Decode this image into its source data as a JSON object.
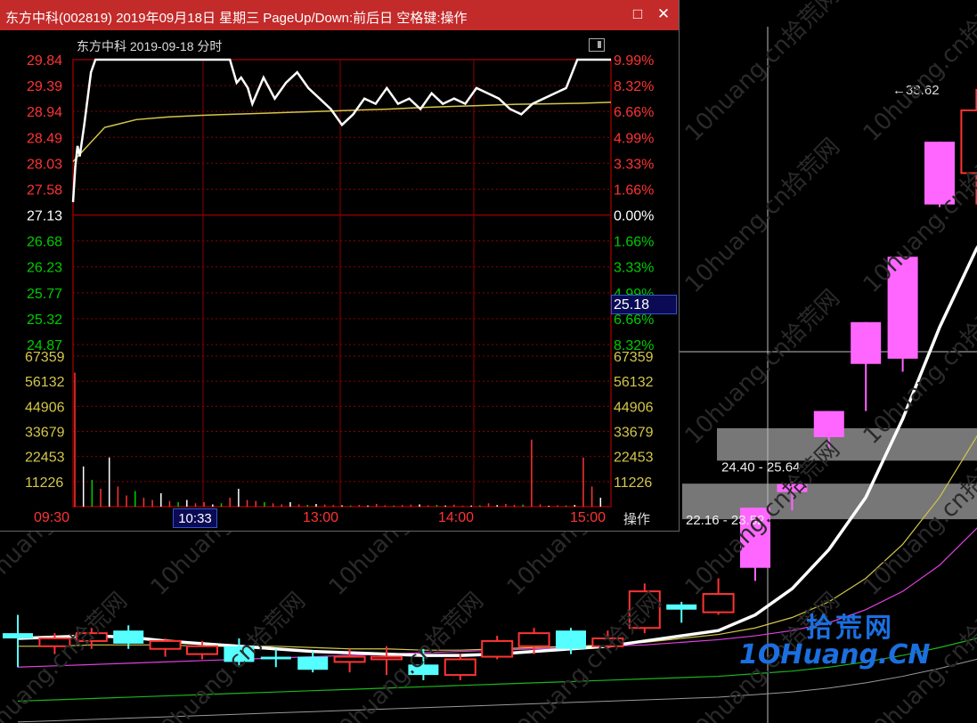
{
  "window": {
    "title": "东方中科(002819) 2019年09月18日 星期三 PageUp/Down:前后日 空格键:操作",
    "subhead": "东方中科  2019-09-18 分时",
    "restore_icon": "□",
    "close_icon": "✕",
    "operate_label": "操作",
    "current_price_box": "25.18",
    "cursor_time_box": "10:33"
  },
  "colors": {
    "up": "#ff3333",
    "down": "#00cc00",
    "neutral": "#ffffff",
    "volume_axis": "#d4c64a",
    "grid": "#8b0000",
    "title_bar": "#c32a2a",
    "magenta": "#ff66ff",
    "cyan": "#55ffff",
    "zone_gray": "#8c8c8c",
    "logo_blue": "#1b6fe0"
  },
  "chart_data": [
    {
      "type": "line",
      "name_shown": "东方中科 2019-09-18 分时",
      "price_ticks_left": [
        "29.84",
        "29.39",
        "28.94",
        "28.49",
        "28.03",
        "27.58",
        "27.13",
        "26.68",
        "26.23",
        "25.77",
        "25.32",
        "24.87"
      ],
      "pct_ticks_right": [
        "9.99%",
        "8.32%",
        "6.66%",
        "4.99%",
        "3.33%",
        "1.66%",
        "0.00%",
        "1.66%",
        "3.33%",
        "4.99%",
        "6.66%",
        "8.32%"
      ],
      "volume_ticks": [
        "67359",
        "56132",
        "44906",
        "33679",
        "22453",
        "11226"
      ],
      "time_ticks": [
        "09:30",
        "10:33",
        "13:00",
        "14:00",
        "15:00"
      ],
      "ylim": [
        24.42,
        29.84
      ],
      "prev_close": 27.13,
      "minutes": [
        0,
        1,
        2,
        3,
        5,
        8,
        10,
        12,
        15,
        20,
        25,
        30,
        40,
        50,
        60,
        70,
        73,
        75,
        78,
        80,
        85,
        90,
        95,
        100,
        105,
        110,
        115,
        120,
        125,
        130,
        135,
        140,
        145,
        150,
        155,
        160,
        165,
        170,
        175,
        180,
        185,
        190,
        195,
        200,
        205,
        210,
        215,
        220,
        225,
        230,
        231,
        232,
        235,
        240
      ],
      "price": [
        27.13,
        27.8,
        28.2,
        28.0,
        28.6,
        29.6,
        29.84,
        29.84,
        29.84,
        29.84,
        29.84,
        29.84,
        29.84,
        29.84,
        29.84,
        29.84,
        29.4,
        29.5,
        29.3,
        29.0,
        29.5,
        29.1,
        29.4,
        29.6,
        29.3,
        29.1,
        28.9,
        28.6,
        28.8,
        29.1,
        29.0,
        29.3,
        29.0,
        29.1,
        28.9,
        29.2,
        29.0,
        29.1,
        29.0,
        29.3,
        29.2,
        29.1,
        28.9,
        28.8,
        29.0,
        29.1,
        29.2,
        29.3,
        29.84,
        29.84,
        29.84,
        29.84,
        29.84,
        29.84
      ],
      "avg_line": [
        27.9,
        28.55,
        28.7,
        28.75,
        28.78,
        28.8,
        28.82,
        28.84,
        28.86,
        28.88,
        28.9,
        28.93,
        28.95,
        28.97,
        28.99,
        29.0,
        29.01,
        29.03
      ],
      "volume_bar_values": [
        60000,
        18000,
        12000,
        8000,
        22000,
        9000,
        5000,
        7000,
        4000,
        3000,
        6000,
        2500,
        2000,
        3000,
        1500,
        2000,
        1000,
        1500,
        4000,
        8000,
        3000,
        2500,
        2000,
        1500,
        1000,
        2000,
        1000,
        800,
        1200,
        900,
        700,
        600,
        500,
        800,
        500,
        1200,
        600,
        500,
        700,
        900,
        1000,
        600,
        800,
        500,
        900,
        400,
        500,
        600,
        1500,
        700,
        1200,
        800,
        900,
        30000,
        1000,
        400,
        600,
        500,
        800,
        22000,
        9000,
        4000
      ]
    },
    {
      "type": "candlestick",
      "annotations": [
        "38.62",
        "24.40 - 25.64",
        "22.16 - 23.52"
      ],
      "ylim": [
        14.5,
        41.0
      ],
      "candles": [
        {
          "o": 17.8,
          "c": 17.6,
          "h": 18.5,
          "l": 16.5
        },
        {
          "o": 17.3,
          "c": 17.6,
          "h": 17.8,
          "l": 17.0
        },
        {
          "o": 17.5,
          "c": 17.8,
          "h": 18.0,
          "l": 17.2
        },
        {
          "o": 17.9,
          "c": 17.4,
          "h": 18.1,
          "l": 17.2
        },
        {
          "o": 17.2,
          "c": 17.5,
          "h": 17.6,
          "l": 16.9
        },
        {
          "o": 17.0,
          "c": 17.3,
          "h": 17.5,
          "l": 16.8
        },
        {
          "o": 17.3,
          "c": 16.7,
          "h": 17.6,
          "l": 16.5
        },
        {
          "o": 16.9,
          "c": 16.8,
          "h": 17.2,
          "l": 16.5
        },
        {
          "o": 16.9,
          "c": 16.4,
          "h": 17.1,
          "l": 16.3
        },
        {
          "o": 16.7,
          "c": 16.9,
          "h": 17.2,
          "l": 16.3
        },
        {
          "o": 16.8,
          "c": 16.9,
          "h": 17.3,
          "l": 16.2
        },
        {
          "o": 16.6,
          "c": 16.2,
          "h": 17.2,
          "l": 16.0
        },
        {
          "o": 16.2,
          "c": 16.8,
          "h": 17.0,
          "l": 16.0
        },
        {
          "o": 16.9,
          "c": 17.5,
          "h": 17.7,
          "l": 16.8
        },
        {
          "o": 17.3,
          "c": 17.8,
          "h": 18.0,
          "l": 17.0
        },
        {
          "o": 17.9,
          "c": 17.2,
          "h": 18.0,
          "l": 17.0
        },
        {
          "o": 17.3,
          "c": 17.6,
          "h": 17.9,
          "l": 17.2
        },
        {
          "o": 18.0,
          "c": 19.4,
          "h": 19.7,
          "l": 17.8
        },
        {
          "o": 18.9,
          "c": 18.7,
          "h": 19.0,
          "l": 18.2
        },
        {
          "o": 18.6,
          "c": 19.3,
          "h": 19.9,
          "l": 18.5
        },
        {
          "o": 20.3,
          "c": 22.6,
          "h": 22.6,
          "l": 19.8
        },
        {
          "o": 23.2,
          "c": 23.5,
          "h": 23.6,
          "l": 22.5
        },
        {
          "o": 25.3,
          "c": 26.3,
          "h": 26.3,
          "l": 24.8
        },
        {
          "o": 28.1,
          "c": 29.7,
          "h": 29.7,
          "l": 26.3
        },
        {
          "o": 28.3,
          "c": 32.2,
          "h": 32.2,
          "l": 27.8
        },
        {
          "o": 34.2,
          "c": 36.6,
          "h": 36.6,
          "l": 34.1
        },
        {
          "o": 35.4,
          "c": 37.8,
          "h": 38.62,
          "l": 34.2
        },
        {
          "o": 37.0,
          "c": 37.2,
          "h": 38.0,
          "l": 35.2
        },
        {
          "o": 35.2,
          "c": 35.0,
          "h": 35.9,
          "l": 32.7
        }
      ],
      "ma_white": [
        17.6,
        17.65,
        17.7,
        17.65,
        17.5,
        17.4,
        17.3,
        17.2,
        17.1,
        17.05,
        17.0,
        16.95,
        16.95,
        17.0,
        17.1,
        17.2,
        17.3,
        17.5,
        17.7,
        17.9,
        18.5,
        19.5,
        21.0,
        23.0,
        26.0,
        29.5,
        32.5,
        34.8,
        35.9
      ],
      "ma_yellow": [
        17.3,
        17.3,
        17.35,
        17.35,
        17.35,
        17.3,
        17.3,
        17.3,
        17.25,
        17.2,
        17.2,
        17.15,
        17.15,
        17.2,
        17.25,
        17.3,
        17.35,
        17.45,
        17.6,
        17.75,
        18.0,
        18.4,
        19.0,
        19.9,
        21.2,
        23.0,
        25.3,
        27.8,
        30.1
      ],
      "ma_magenta": [
        16.5,
        16.55,
        16.6,
        16.65,
        16.7,
        16.75,
        16.8,
        16.85,
        16.9,
        16.95,
        17.0,
        17.05,
        17.1,
        17.15,
        17.2,
        17.25,
        17.3,
        17.35,
        17.45,
        17.55,
        17.7,
        17.9,
        18.2,
        18.7,
        19.4,
        20.4,
        21.8,
        23.6,
        25.5
      ],
      "ma_green": [
        15.2,
        15.25,
        15.3,
        15.35,
        15.4,
        15.45,
        15.5,
        15.55,
        15.6,
        15.65,
        15.7,
        15.75,
        15.8,
        15.85,
        15.9,
        15.95,
        16.0,
        16.05,
        16.1,
        16.15,
        16.25,
        16.35,
        16.5,
        16.7,
        16.95,
        17.25,
        17.6,
        18.0,
        18.4
      ]
    }
  ],
  "logo": {
    "text_cn": "拾荒网",
    "text_en": "1OHuang.CN"
  },
  "watermark": "10huang.cn拾荒网"
}
